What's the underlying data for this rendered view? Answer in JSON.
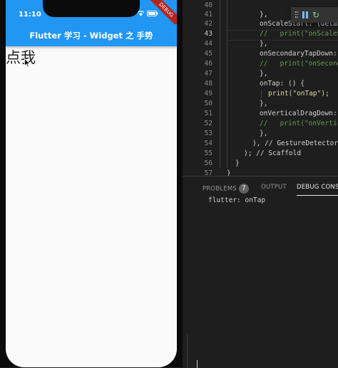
{
  "phone": {
    "time": "11:10",
    "debug_ribbon": "DEBUG",
    "app_title": "Flutter 学习 - Widget 之 手势",
    "tap_text": "点我"
  },
  "editor": {
    "lines": [
      {
        "num": "40",
        "text": ""
      },
      {
        "num": "41",
        "text": "},"
      },
      {
        "num": "42",
        "text": "onScaleStart: (details) {"
      },
      {
        "num": "43",
        "text": "//   print(\"onScaleStart\");"
      },
      {
        "num": "44",
        "text": "},"
      },
      {
        "num": "45",
        "text": "onSecondaryTapDown: (details) {"
      },
      {
        "num": "46",
        "text": "//   print(\"onSecondaryTapDown\");"
      },
      {
        "num": "47",
        "text": "},"
      },
      {
        "num": "48",
        "text": "onTap: () {"
      },
      {
        "num": "49",
        "text": "print(\"onTap\");"
      },
      {
        "num": "50",
        "text": "},"
      },
      {
        "num": "51",
        "text": "onVerticalDragDown: (details) {"
      },
      {
        "num": "52",
        "text": "//   print(\"onVerticalDragDown\");"
      },
      {
        "num": "53",
        "text": "},"
      },
      {
        "num": "54",
        "text": "), // GestureDetector"
      },
      {
        "num": "55",
        "text": "); // Scaffold"
      },
      {
        "num": "56",
        "text": "}"
      },
      {
        "num": "57",
        "text": "}"
      }
    ]
  },
  "panel": {
    "tabs": {
      "problems": "PROBLEMS",
      "problems_count": "7",
      "output": "OUTPUT",
      "debug_console": "DEBUG CONSOLE"
    },
    "console_output": "flutter: onTap"
  },
  "colors": {
    "app_bar": "#2196f3",
    "phone_bg": "#fafafa",
    "editor_bg": "#1e1e1e",
    "comment": "#6a9955",
    "string": "#ce9178",
    "function": "#dcdcaa"
  }
}
